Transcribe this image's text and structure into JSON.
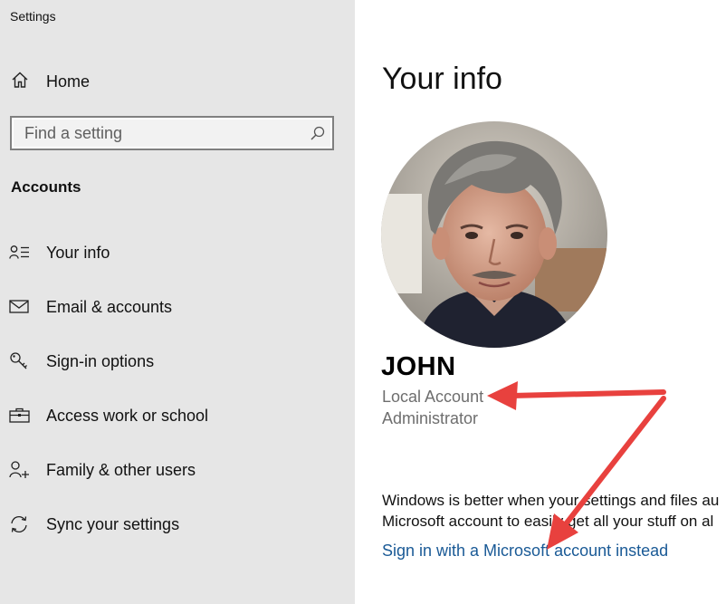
{
  "app": {
    "title": "Settings"
  },
  "sidebar": {
    "home_label": "Home",
    "search": {
      "placeholder": "Find a setting",
      "value": ""
    },
    "section_title": "Accounts",
    "items": [
      {
        "label": "Your info",
        "icon": "person-list-icon"
      },
      {
        "label": "Email & accounts",
        "icon": "mail-icon"
      },
      {
        "label": "Sign-in options",
        "icon": "key-icon"
      },
      {
        "label": "Access work or school",
        "icon": "briefcase-icon"
      },
      {
        "label": "Family & other users",
        "icon": "person-add-icon"
      },
      {
        "label": "Sync your settings",
        "icon": "sync-icon"
      }
    ]
  },
  "main": {
    "title": "Your info",
    "user": {
      "name": "JOHN",
      "account_type": "Local Account",
      "role": "Administrator"
    },
    "promo_lines": [
      "Windows is better when your settings and files au",
      "Microsoft account to easily get all your stuff on al"
    ],
    "signin_link": "Sign in with a Microsoft account instead"
  },
  "colors": {
    "sidebar_bg": "#e6e6e6",
    "link": "#1a5a96",
    "annotation_arrow": "#e8413e"
  }
}
